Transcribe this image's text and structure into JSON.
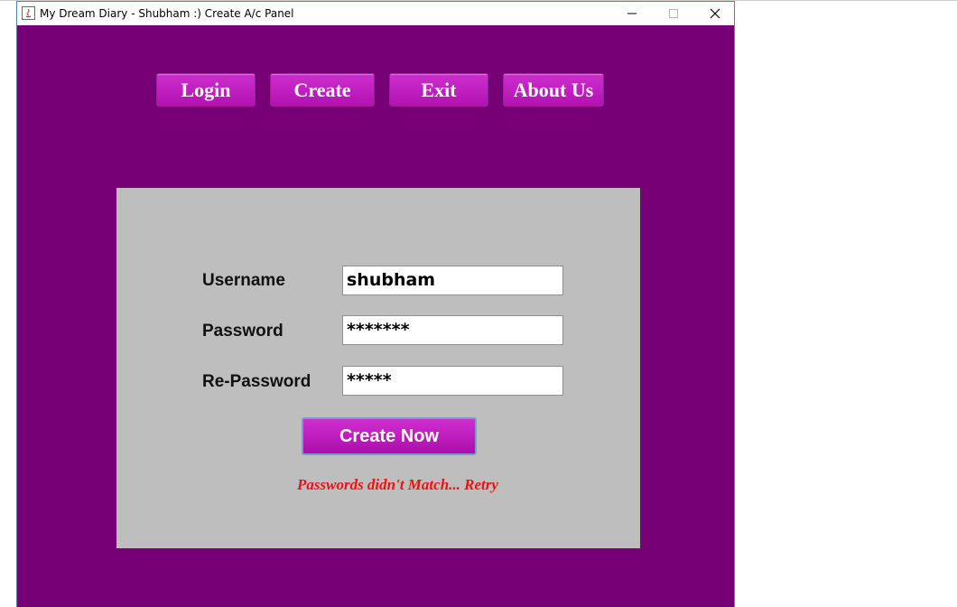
{
  "window": {
    "title": "My Dream Diary - Shubham :) Create A/c Panel",
    "background": "#770077"
  },
  "nav": {
    "login_label": "Login",
    "create_label": "Create",
    "exit_label": "Exit",
    "about_label": "About Us"
  },
  "form": {
    "username_label": "Username",
    "username_value": "shubham",
    "password_label": "Password",
    "password_value": "*******",
    "repassword_label": "Re-Password",
    "repassword_value": "*****",
    "submit_label": "Create Now",
    "error_message": "Passwords didn't Match... Retry",
    "error_color": "#ee1111",
    "panel_color": "#bebebe"
  }
}
